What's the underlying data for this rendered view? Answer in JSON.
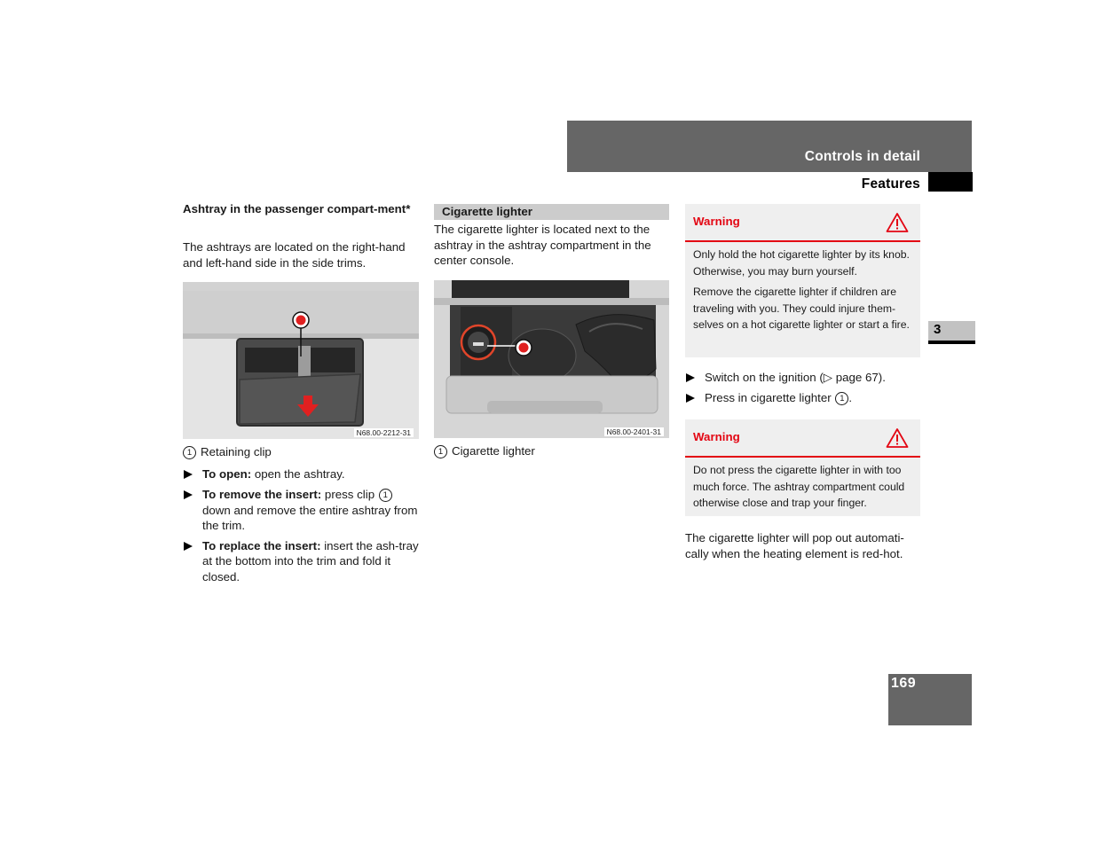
{
  "header": {
    "chapter_title": "Controls in detail",
    "section_title": "Features"
  },
  "side_tab": {
    "chapter_number": "3"
  },
  "page_number": "169",
  "colors": {
    "header_band": "#666666",
    "warning_red": "#e30613",
    "warning_bg": "#efefef",
    "subheading_bg": "#cccccc"
  },
  "ashtray": {
    "heading": "Ashtray in the passenger compart-ment*",
    "intro": "The ashtrays are located on the right-hand and left-hand side in the side trims.",
    "figure": {
      "code": "N68.00-2212-31",
      "callout": "1",
      "description": "Ashtray in side trim with retaining clip and red downward arrow"
    },
    "legend": {
      "number": "1",
      "label": "Retaining clip"
    },
    "steps": [
      {
        "lead": "To open:",
        "text": " open the ashtray."
      },
      {
        "lead": "To remove the insert:",
        "text": " press clip ",
        "ref": "1",
        "text_after": " down and remove the entire ashtray from the trim."
      },
      {
        "lead": "To replace the insert:",
        "text": " insert the ash-tray at the bottom into the trim and fold it closed."
      }
    ]
  },
  "lighter": {
    "heading": "Cigarette lighter",
    "intro": "The cigarette lighter is located next to the ashtray in the ashtray compartment in the center console.",
    "figure": {
      "code": "N68.00-2401-31",
      "callout": "1",
      "description": "Center console ashtray compartment with cigarette lighter highlighted in red"
    },
    "legend": {
      "number": "1",
      "label": "Cigarette lighter"
    },
    "warning1": {
      "title": "Warning",
      "icon": "warning-triangle-icon",
      "paragraphs": [
        "Only hold the hot cigarette lighter by its knob. Otherwise, you may burn yourself.",
        "Remove the cigarette lighter if children are traveling with you. They could injure them-selves on a hot cigarette lighter or start a fire."
      ]
    },
    "steps": [
      {
        "text": "Switch on the ignition (",
        "ref_symbol": "▷",
        "ref_text": " page 67)."
      },
      {
        "text": "Press in cigarette lighter ",
        "ref": "1",
        "text_after": "."
      }
    ],
    "warning2": {
      "title": "Warning",
      "icon": "warning-triangle-icon",
      "paragraphs": [
        "Do not press the cigarette lighter in with too much force. The ashtray compartment could otherwise close and trap your finger."
      ]
    },
    "outro": "The cigarette lighter will pop out automati-cally when the heating element is red-hot."
  }
}
